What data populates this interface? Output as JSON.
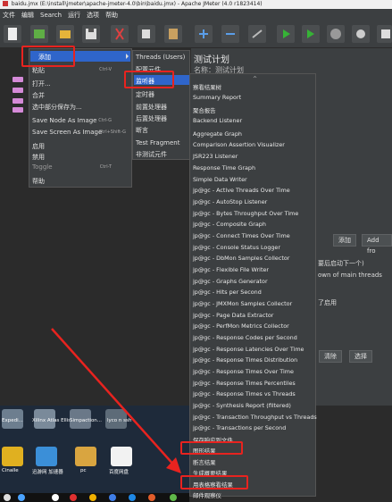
{
  "window": {
    "title": "baidu.jmx (E:\\install\\jmeter\\apache-jmeter-4.0\\bin\\baidu.jmx) - Apache JMeter (4.0 r1823414)"
  },
  "menubar": [
    "文件",
    "编辑",
    "Search",
    "运行",
    "选项",
    "帮助"
  ],
  "context_menu": {
    "items": [
      {
        "label": "添加",
        "shortcut": "",
        "has_submenu": true
      },
      {
        "label": "粘贴",
        "shortcut": "Ctrl-V"
      },
      {
        "label": "打开...",
        "shortcut": ""
      },
      {
        "label": "合并",
        "shortcut": ""
      },
      {
        "label": "选中部分保存为...",
        "shortcut": ""
      },
      {
        "label": "Save Node As Image",
        "shortcut": "Ctrl-G"
      },
      {
        "label": "Save Screen As Image",
        "shortcut": "Ctrl+Shift-G"
      },
      {
        "label": "启用",
        "shortcut": ""
      },
      {
        "label": "禁用",
        "shortcut": ""
      },
      {
        "label": "Toggle",
        "shortcut": "Ctrl-T"
      },
      {
        "label": "帮助",
        "shortcut": ""
      }
    ]
  },
  "add_submenu": {
    "items": [
      "Threads (Users)",
      "配置元件",
      "监听器",
      "定时器",
      "前置处理器",
      "后置处理器",
      "断言",
      "Test Fragment",
      "非测试元件"
    ]
  },
  "listener_submenu": {
    "items": [
      "察看结果树",
      "Summary Report",
      "聚合报告",
      "Backend Listener",
      "Aggregate Graph",
      "Comparison Assertion Visualizer",
      "JSR223 Listener",
      "Response Time Graph",
      "Simple Data Writer",
      "jp@gc - Active Threads Over Time",
      "jp@gc - AutoStop Listener",
      "jp@gc - Bytes Throughput Over Time",
      "jp@gc - Composite Graph",
      "jp@gc - Connect Times Over Time",
      "jp@gc - Console Status Logger",
      "jp@gc - DbMon Samples Collector",
      "jp@gc - Flexible File Writer",
      "jp@gc - Graphs Generator",
      "jp@gc - Hits per Second",
      "jp@gc - JMXMon Samples Collector",
      "jp@gc - Page Data Extractor",
      "jp@gc - PerfMon Metrics Collector",
      "jp@gc - Response Codes per Second",
      "jp@gc - Response Latencies Over Time",
      "jp@gc - Response Times Distribution",
      "jp@gc - Response Times Over Time",
      "jp@gc - Response Times Percentiles",
      "jp@gc - Response Times vs Threads",
      "jp@gc - Synthesis Report (filtered)",
      "jp@gc - Transaction Throughput vs Threads",
      "jp@gc - Transactions per Second",
      "保存响应到文件",
      "图形结果",
      "断言结果",
      "生成概要结果",
      "用表格察看结果",
      "邮件观察仪"
    ]
  },
  "right_panel": {
    "title": "测试计划",
    "name_label": "名称：",
    "name_value": "测试计划",
    "add_button": "添加",
    "add_from_button": "Add fro",
    "text1": "要后启动下一个)",
    "text2": "own of main threads",
    "text3": "了启用",
    "delete_button": "清除",
    "browse_button": "浏览",
    "select_button": "选择"
  },
  "desktop": {
    "labels": [
      "Expedi...",
      "Xilinx Atlas Ellis...",
      "Simpaction...",
      "lyco n ssh",
      "Cinalle",
      "迅游网 加速器",
      "pc",
      "百度网盘"
    ]
  },
  "colors": {
    "highlight": "#e8231f",
    "selection": "#2f65ca",
    "menu_bg": "#3c3f41"
  }
}
